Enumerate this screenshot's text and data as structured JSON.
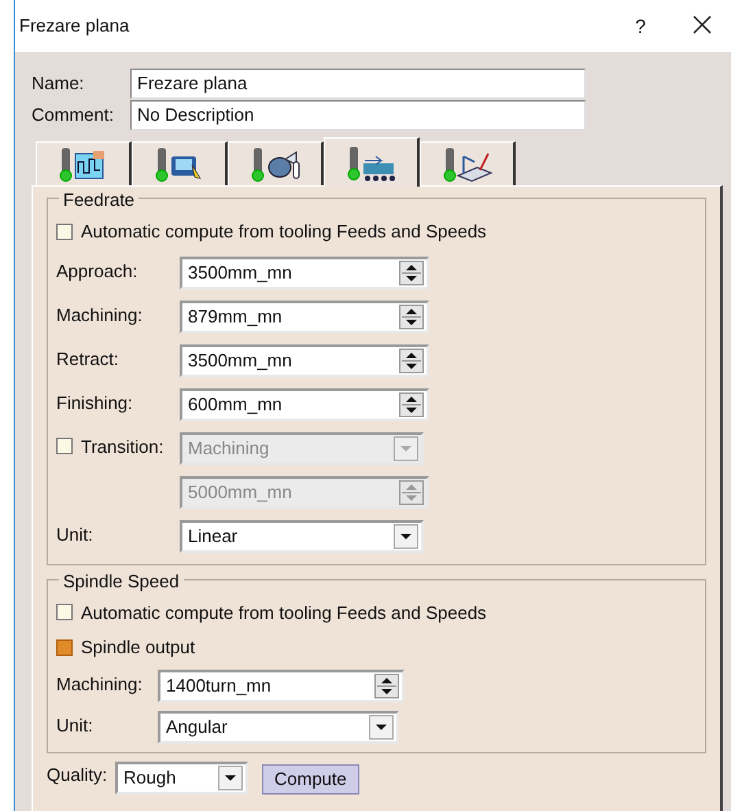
{
  "window": {
    "title": "Frezare plana",
    "help": "?"
  },
  "fields": [
    {
      "label": "Name:",
      "value": "Frezare plana"
    },
    {
      "label": "Comment:",
      "value": "No Description"
    }
  ],
  "tabs": [
    {
      "selected": false
    },
    {
      "selected": false
    },
    {
      "selected": false
    },
    {
      "selected": true
    },
    {
      "selected": false
    }
  ],
  "feedrate": {
    "title": "Feedrate",
    "auto": {
      "label": "Automatic compute from tooling Feeds and Speeds",
      "checked": false
    },
    "rows": [
      {
        "kind": "spinner",
        "label": "Approach:",
        "value": "3500mm_mn",
        "disabled": false
      },
      {
        "kind": "spinner",
        "label": "Machining:",
        "value": "879mm_mn",
        "disabled": false
      },
      {
        "kind": "spinner",
        "label": "Retract:",
        "value": "3500mm_mn",
        "disabled": false
      },
      {
        "kind": "spinner",
        "label": "Finishing:",
        "value": "600mm_mn",
        "disabled": false
      },
      {
        "kind": "check-combo",
        "label": "Transition:",
        "checked": false,
        "value": "Machining",
        "disabled": true
      },
      {
        "kind": "spinner",
        "value": "5000mm_mn",
        "disabled": true
      },
      {
        "kind": "combo",
        "label": "Unit:",
        "value": "Linear",
        "disabled": false
      }
    ]
  },
  "spindle": {
    "title": "Spindle Speed",
    "auto": {
      "label": "Automatic compute from tooling Feeds and Speeds",
      "checked": false
    },
    "output": {
      "label": "Spindle output",
      "checked": true
    },
    "rows": [
      {
        "kind": "spinner",
        "label": "Machining:",
        "value": "1400turn_mn",
        "disabled": false
      },
      {
        "kind": "combo",
        "label": "Unit:",
        "value": "Angular",
        "disabled": false
      }
    ]
  },
  "quality": {
    "label": "Quality:",
    "value": "Rough",
    "button": "Compute"
  }
}
